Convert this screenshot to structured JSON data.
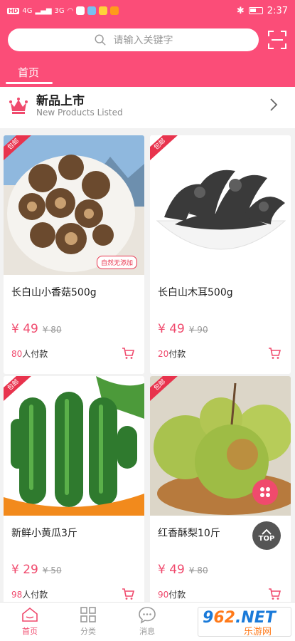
{
  "status_bar": {
    "time": "2:37",
    "network_left": "HD",
    "signal_1": "4G",
    "signal_2": "3G"
  },
  "search": {
    "placeholder": "请输入关键字"
  },
  "tabs": {
    "home_label": "首页"
  },
  "new_products": {
    "title": "新品上市",
    "subtitle": "New Products Listed"
  },
  "products": [
    {
      "tag": "包邮",
      "name": "长白山小香菇500g",
      "price": "¥ 49",
      "old_price": "¥ 80",
      "paid_count": "80",
      "paid_suffix": "人付款",
      "badge": "自然无添加"
    },
    {
      "tag": "包邮",
      "name": "长白山木耳500g",
      "price": "¥ 49",
      "old_price": "¥ 90",
      "paid_count": "20",
      "paid_suffix": "付款"
    },
    {
      "tag": "包邮",
      "name": "新鲜小黄瓜3斤",
      "price": "¥ 29",
      "old_price": "¥ 50",
      "paid_count": "98",
      "paid_suffix": "人付款"
    },
    {
      "tag": "包邮",
      "name": "红香酥梨10斤",
      "price": "¥ 49",
      "old_price": "¥ 80",
      "paid_count": "90",
      "paid_suffix": "付款"
    }
  ],
  "floating": {
    "top_label": "TOP"
  },
  "bottom_nav": {
    "home": "首页",
    "category": "分类",
    "messages": "消息"
  },
  "watermark": {
    "logo_a": "9",
    "logo_b": "62",
    "logo_c": ".NET",
    "sub": "乐游网"
  },
  "colors": {
    "brand": "#fb4d78",
    "price": "#f04a6d",
    "tag": "#e8334d"
  }
}
